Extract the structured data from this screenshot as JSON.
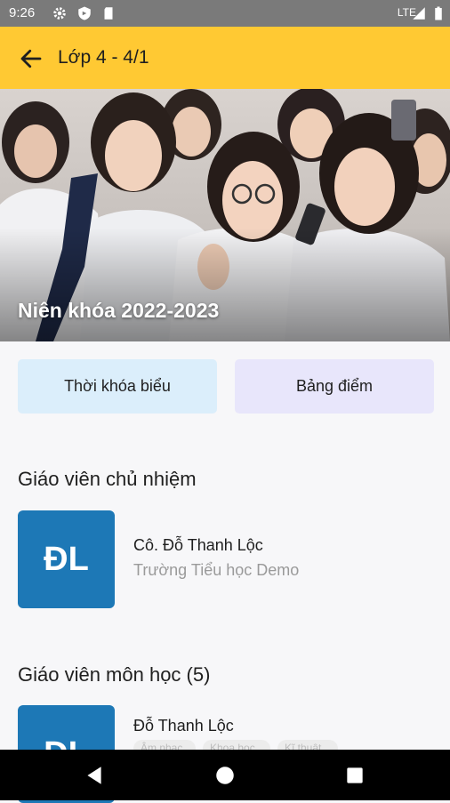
{
  "status_bar": {
    "time": "9:26",
    "network": "LTE"
  },
  "app_bar": {
    "title": "Lớp 4 - 4/1"
  },
  "hero": {
    "caption": "Niên khóa 2022-2023"
  },
  "actions": {
    "timetable_label": "Thời khóa biểu",
    "grades_label": "Bảng điểm"
  },
  "homeroom": {
    "section_title": "Giáo viên chủ nhiệm",
    "avatar_initials": "ĐL",
    "name": "Cô. Đỗ Thanh Lộc",
    "school": "Trường Tiểu học Demo"
  },
  "subject_teachers": {
    "section_title": "Giáo viên môn học (5)",
    "first": {
      "avatar_initials": "ĐL",
      "name": "Đỗ Thanh Lộc",
      "subjects": [
        "Âm nhạc",
        "Khoa học",
        "Kĩ thuật"
      ]
    }
  },
  "colors": {
    "appbar": "#ffc933",
    "avatar": "#1d78b6",
    "timetable_bg": "#dbeefb",
    "grades_bg": "#e8e6fb"
  },
  "icons": [
    "settings-icon",
    "shield-icon",
    "sd-card-icon",
    "signal-icon",
    "battery-icon",
    "back-arrow-icon",
    "nav-back-icon",
    "nav-home-icon",
    "nav-recents-icon"
  ]
}
